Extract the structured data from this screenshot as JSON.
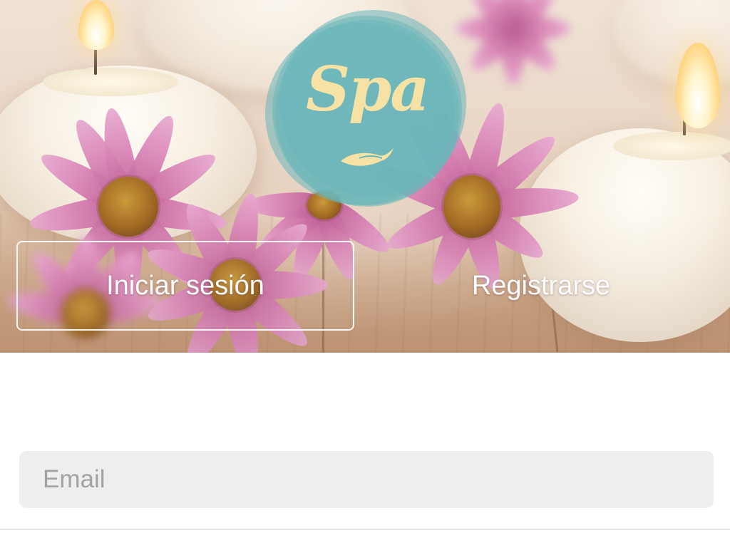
{
  "logo": {
    "text": "Spa",
    "colors": {
      "circle": "#69b7ba",
      "text": "#f7e2a6"
    }
  },
  "auth_tabs": {
    "login_label": "Iniciar sesión",
    "register_label": "Registrarse",
    "active": "login"
  },
  "form": {
    "email": {
      "placeholder": "Email",
      "value": ""
    }
  },
  "hero": {
    "image_subject_icons": [
      "candle-icon",
      "flower-icon"
    ]
  }
}
